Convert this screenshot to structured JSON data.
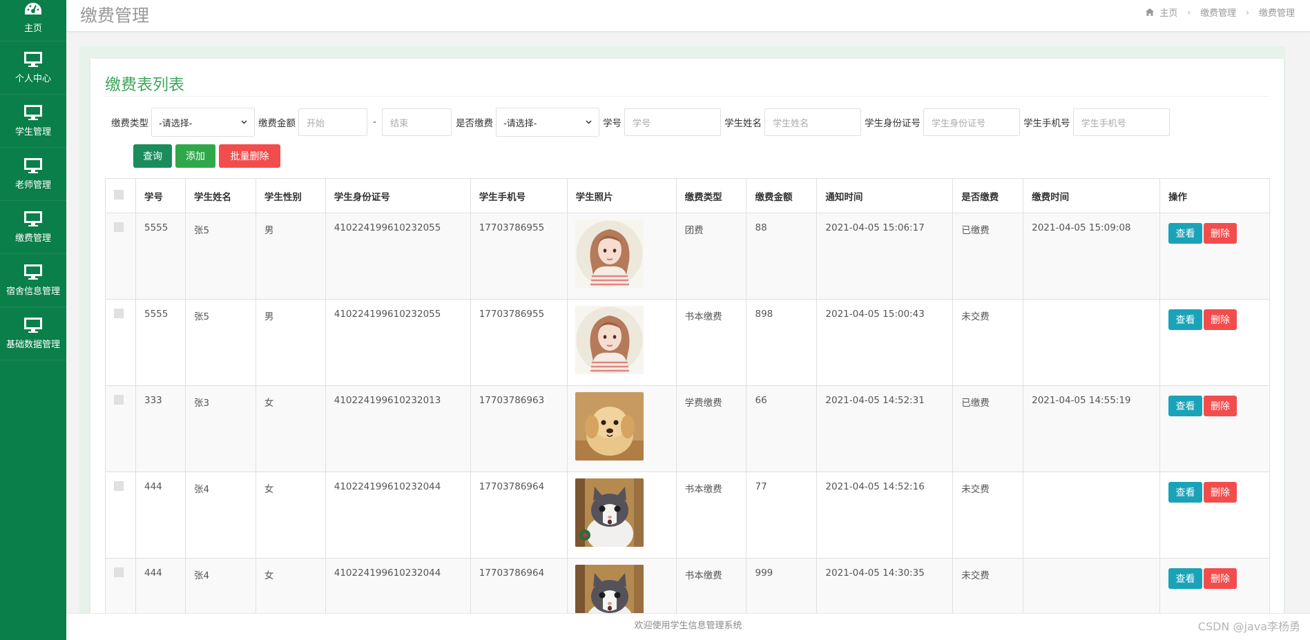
{
  "sidebar": {
    "items": [
      {
        "label": "主页",
        "icon": "dashboard-icon"
      },
      {
        "label": "个人中心",
        "icon": "monitor-icon"
      },
      {
        "label": "学生管理",
        "icon": "monitor-icon"
      },
      {
        "label": "老师管理",
        "icon": "monitor-icon"
      },
      {
        "label": "缴费管理",
        "icon": "monitor-icon"
      },
      {
        "label": "宿舍信息管理",
        "icon": "monitor-icon"
      },
      {
        "label": "基础数据管理",
        "icon": "monitor-icon"
      }
    ]
  },
  "header": {
    "title": "缴费管理",
    "breadcrumb": [
      "主页",
      "缴费管理",
      "缴费管理"
    ]
  },
  "card": {
    "title": "缴费表列表"
  },
  "filters": {
    "fee_type_label": "缴费类型",
    "fee_type_value": "-请选择-",
    "amount_label": "缴费金额",
    "amount_start_placeholder": "开始",
    "amount_sep": "-",
    "amount_end_placeholder": "结束",
    "paid_label": "是否缴费",
    "paid_value": "-请选择-",
    "student_no_label": "学号",
    "student_no_placeholder": "学号",
    "student_name_label": "学生姓名",
    "student_name_placeholder": "学生姓名",
    "id_card_label": "学生身份证号",
    "id_card_placeholder": "学生身份证号",
    "phone_label": "学生手机号",
    "phone_placeholder": "学生手机号"
  },
  "buttons": {
    "query": "查询",
    "add": "添加",
    "batch_delete": "批量删除"
  },
  "table": {
    "columns": [
      "学号",
      "学生姓名",
      "学生性别",
      "学生身份证号",
      "学生手机号",
      "学生照片",
      "缴费类型",
      "缴费金额",
      "通知时间",
      "是否缴费",
      "缴费时间",
      "操作"
    ],
    "view_label": "查看",
    "delete_label": "删除",
    "rows": [
      {
        "no": "5555",
        "name": "张5",
        "gender": "男",
        "id_card": "410224199610232055",
        "phone": "17703786955",
        "photo": "girl",
        "fee_type": "团费",
        "amount": "88",
        "notify_time": "2021-04-05 15:06:17",
        "paid": "已缴费",
        "pay_time": "2021-04-05 15:09:08"
      },
      {
        "no": "5555",
        "name": "张5",
        "gender": "男",
        "id_card": "410224199610232055",
        "phone": "17703786955",
        "photo": "girl",
        "fee_type": "书本缴费",
        "amount": "898",
        "notify_time": "2021-04-05 15:00:43",
        "paid": "未交费",
        "pay_time": ""
      },
      {
        "no": "333",
        "name": "张3",
        "gender": "女",
        "id_card": "410224199610232013",
        "phone": "17703786963",
        "photo": "puppy",
        "fee_type": "学费缴费",
        "amount": "66",
        "notify_time": "2021-04-05 14:52:31",
        "paid": "已缴费",
        "pay_time": "2021-04-05 14:55:19"
      },
      {
        "no": "444",
        "name": "张4",
        "gender": "女",
        "id_card": "410224199610232044",
        "phone": "17703786964",
        "photo": "cat",
        "fee_type": "书本缴费",
        "amount": "77",
        "notify_time": "2021-04-05 14:52:16",
        "paid": "未交费",
        "pay_time": ""
      },
      {
        "no": "444",
        "name": "张4",
        "gender": "女",
        "id_card": "410224199610232044",
        "phone": "17703786964",
        "photo": "cat",
        "fee_type": "书本缴费",
        "amount": "999",
        "notify_time": "2021-04-05 14:30:35",
        "paid": "未交费",
        "pay_time": ""
      }
    ]
  },
  "footer": {
    "text": "欢迎使用学生信息管理系统"
  },
  "watermark": "CSDN @java李杨勇",
  "colors": {
    "sidebar": "#0b7f49",
    "accent": "#3fa65d",
    "view": "#1aa3b8",
    "danger": "#f24d4d"
  }
}
